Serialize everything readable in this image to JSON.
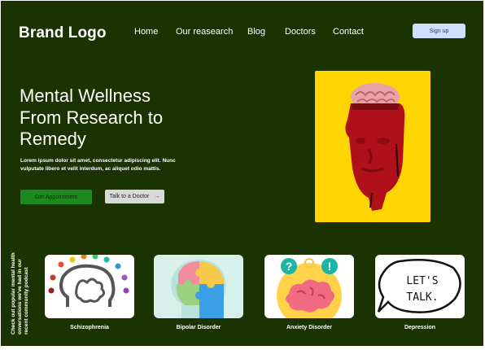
{
  "header": {
    "logo": "Brand Logo",
    "nav": [
      "Home",
      "Our reasearch",
      "Blog",
      "Doctors",
      "Contact"
    ],
    "signup": "Sign up"
  },
  "hero": {
    "headline_lines": [
      "Mental Wellness",
      "From Research to",
      "Remedy"
    ],
    "lead": "Lorem ipsum dolor sit amet, consectetur adipiscing elit. Nunc vulputate libero et velit interdum, ac aliquet odio mattis.",
    "primary_button": "Get Appointment",
    "secondary_button": "Talk to a Doctor",
    "secondary_arrow": "→"
  },
  "podcast": {
    "side_text": "Check out popular mental health onversations we've had in our recent community podcast",
    "cards": [
      {
        "label": "Schizophrenia"
      },
      {
        "label": "Bipolar Disorder"
      },
      {
        "label": "Anxiety Disorder"
      },
      {
        "label": "Depression"
      }
    ],
    "depression_art_text": [
      "LET'S",
      "TALK."
    ],
    "anxiety_icons": [
      "?",
      "!"
    ]
  },
  "colors": {
    "background": "#1a3300",
    "hero_yellow": "#ffd400",
    "primary_button": "#1e8a1e",
    "signup": "#cfe0ff"
  }
}
